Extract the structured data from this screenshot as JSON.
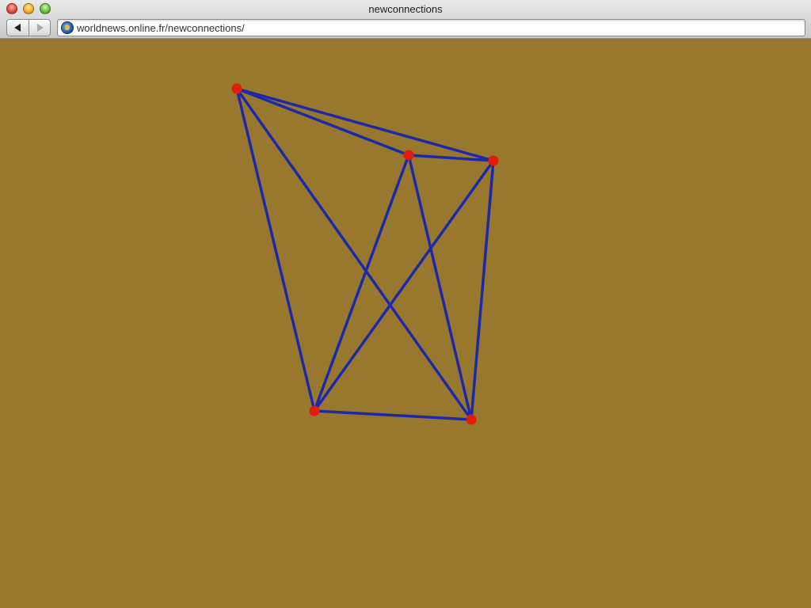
{
  "window": {
    "title": "newconnections",
    "url": "worldnews.online.fr/newconnections/"
  },
  "colors": {
    "background": "#98782e",
    "edge": "#1d2aa8",
    "node": "#e01b10"
  },
  "game": {
    "nodes": [
      {
        "id": "a"
      },
      {
        "id": "b"
      },
      {
        "id": "c"
      },
      {
        "id": "d"
      },
      {
        "id": "e"
      }
    ],
    "edges": [
      [
        "a",
        "b"
      ],
      [
        "a",
        "c"
      ],
      [
        "a",
        "d"
      ],
      [
        "a",
        "e"
      ],
      [
        "b",
        "c"
      ],
      [
        "b",
        "d"
      ],
      [
        "b",
        "e"
      ],
      [
        "c",
        "d"
      ],
      [
        "c",
        "e"
      ],
      [
        "d",
        "e"
      ]
    ]
  }
}
